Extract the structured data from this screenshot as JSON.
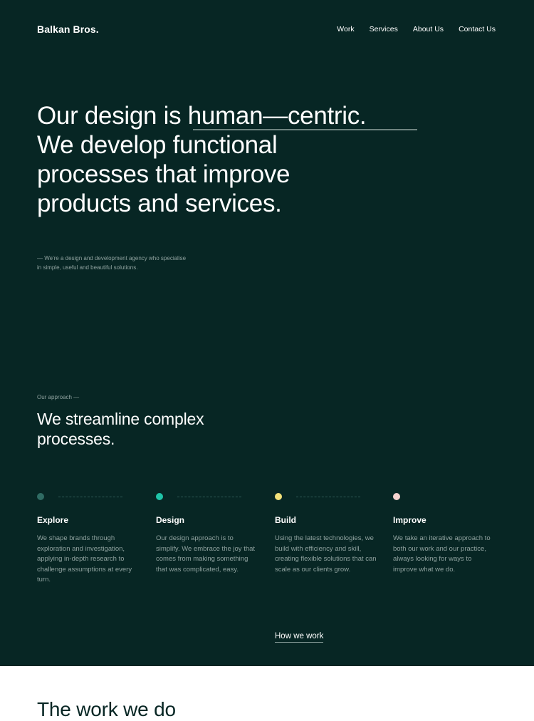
{
  "header": {
    "logo": "Balkan Bros.",
    "nav": [
      "Work",
      "Services",
      "About Us",
      "Contact Us"
    ]
  },
  "hero": {
    "line1_prefix": "Our design is ",
    "line1_highlight": "human—centric.",
    "line2": "We develop functional",
    "line3": "processes that improve",
    "line4": "products and services."
  },
  "tagline": {
    "line1": "— We're a design and development agency who specialise",
    "line2": "in simple, useful and beautiful solutions."
  },
  "approach": {
    "eyebrow": "Our approach —",
    "title_line1": "We streamline complex",
    "title_line2": "processes.",
    "steps": [
      {
        "title": "Explore",
        "color": "#2f6b63",
        "description": "We shape brands through exploration and investigation, applying in-depth research to challenge assumptions at every turn."
      },
      {
        "title": "Design",
        "color": "#1fc4a8",
        "description": "Our design approach is to simplify. We embrace the joy that comes from making something that was complicated, easy."
      },
      {
        "title": "Build",
        "color": "#f3e27a",
        "description": "Using the latest technologies, we build with efficiency and skill, creating flexible solutions that can scale as our clients grow."
      },
      {
        "title": "Improve",
        "color": "#f6d3cf",
        "description": "We take an iterative approach to both our work and our practice, always looking for ways to improve what we do."
      }
    ],
    "link": "How we work"
  },
  "next_section": {
    "heading": "The work we do"
  }
}
